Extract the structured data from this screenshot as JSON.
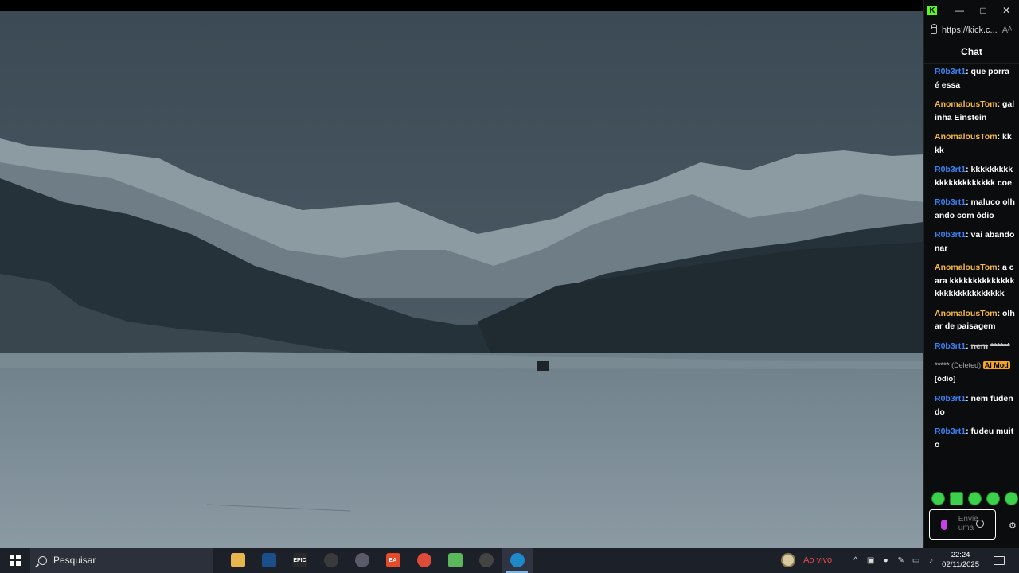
{
  "window": {
    "url": "https://kick.c...",
    "reader_icon": "Aᴬ"
  },
  "chat": {
    "title": "Chat",
    "messages": [
      {
        "user": "R0b3rt1",
        "color": "#3b82f6",
        "text": "que porra é essa"
      },
      {
        "user": "AnomalousTom",
        "color": "#f5b942",
        "text": "galinha Einstein"
      },
      {
        "user": "AnomalousTom",
        "color": "#f5b942",
        "text": "kkkk"
      },
      {
        "user": "R0b3rt1",
        "color": "#3b82f6",
        "text": "kkkkkkkkkkkkkkkkkkkkkk coe"
      },
      {
        "user": "R0b3rt1",
        "color": "#3b82f6",
        "text": "maluco olhando com ódio"
      },
      {
        "user": "R0b3rt1",
        "color": "#3b82f6",
        "text": "vai abandonar"
      },
      {
        "user": "AnomalousTom",
        "color": "#f5b942",
        "text": "a cara kkkkkkkkkkkkkkkkkkkkkkkkkkkkk"
      },
      {
        "user": "AnomalousTom",
        "color": "#f5b942",
        "text": "olhar de paisagem"
      },
      {
        "user": "R0b3rt1",
        "color": "#3b82f6",
        "text": "nem",
        "extra": "******",
        "struck": true
      },
      {
        "deleted": true,
        "text": "*****",
        "deleted_label": "(Deleted)",
        "badge": "AI Mod",
        "reason": "[ódio]"
      },
      {
        "user": "R0b3rt1",
        "color": "#3b82f6",
        "text": "nem fudendo"
      },
      {
        "user": "R0b3rt1",
        "color": "#3b82f6",
        "text": "fudeu muito"
      }
    ],
    "input_placeholder": "Envie uma mensagem"
  },
  "taskbar": {
    "search_placeholder": "Pesquisar",
    "apps": [
      {
        "name": "file-explorer",
        "label": "",
        "color": "#e8b64a"
      },
      {
        "name": "steam",
        "label": "",
        "color": "#1b4f8a"
      },
      {
        "name": "epic-games",
        "label": "EPIC",
        "color": "#2a2a2a"
      },
      {
        "name": "game-app",
        "label": "",
        "color": "#3a3a3a"
      },
      {
        "name": "obs",
        "label": "",
        "color": "#5a5a6a"
      },
      {
        "name": "ea-app",
        "label": "EA",
        "color": "#e54b2b"
      },
      {
        "name": "chrome",
        "label": "",
        "color": "#dd4b39"
      },
      {
        "name": "android-app",
        "label": "",
        "color": "#5cb85c"
      },
      {
        "name": "speedometer-app",
        "label": "",
        "color": "#444"
      },
      {
        "name": "edge",
        "label": "",
        "color": "#1e88c8"
      }
    ],
    "live_label": "Ao vivo",
    "time": "22:24",
    "date": "02/11/2025"
  }
}
